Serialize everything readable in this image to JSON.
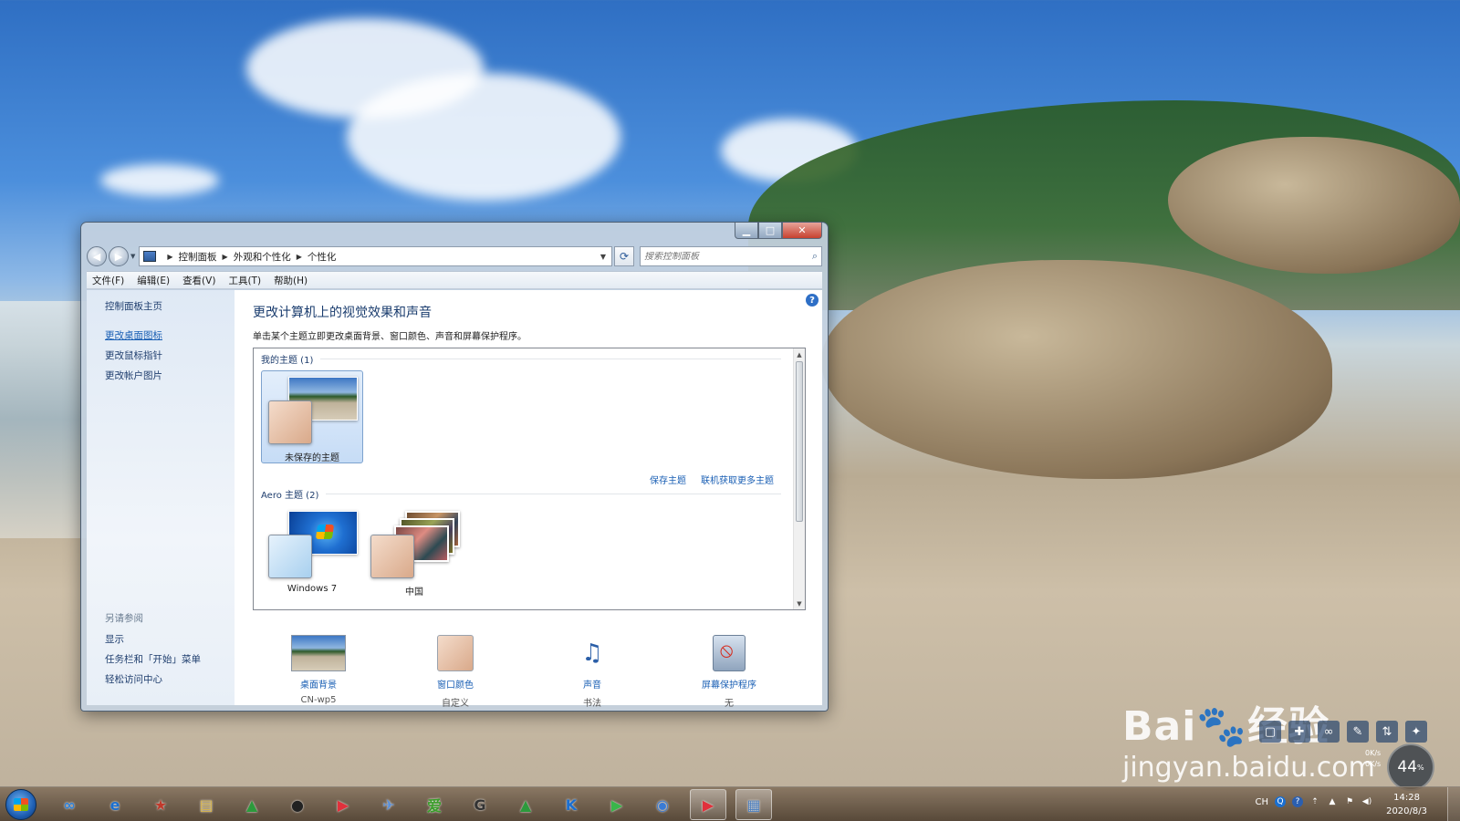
{
  "desktop": {
    "watermark_brand": "Bai",
    "watermark_brand2": "经验",
    "watermark_url": "jingyan.baidu.com",
    "speed_percent": "44",
    "speed_unit": "%",
    "net_up": "0",
    "net_unit": "K/s"
  },
  "window": {
    "caption_buttons": {
      "minimize": "▁",
      "maximize": "□",
      "close": "✕"
    },
    "nav": {
      "back": "◀",
      "forward": "▶"
    },
    "breadcrumb": [
      "控制面板",
      "外观和个性化",
      "个性化"
    ],
    "search_placeholder": "搜索控制面板",
    "menu": [
      "文件(F)",
      "编辑(E)",
      "查看(V)",
      "工具(T)",
      "帮助(H)"
    ],
    "sidebar": {
      "home": "控制面板主页",
      "links": [
        "更改桌面图标",
        "更改鼠标指针",
        "更改帐户图片"
      ],
      "see_also_header": "另请参阅",
      "see_also": [
        "显示",
        "任务栏和「开始」菜单",
        "轻松访问中心"
      ]
    },
    "main": {
      "title": "更改计算机上的视觉效果和声音",
      "description": "单击某个主题立即更改桌面背景、窗口颜色、声音和屏幕保护程序。",
      "my_themes_header": "我的主题 (1)",
      "my_themes": [
        {
          "name": "未保存的主题",
          "selected": true
        }
      ],
      "save_theme": "保存主题",
      "get_more": "联机获取更多主题",
      "aero_header": "Aero 主题 (2)",
      "aero_themes": [
        {
          "name": "Windows 7"
        },
        {
          "name": "中国"
        }
      ],
      "bottom": [
        {
          "label": "桌面背景",
          "sub": "CN-wp5",
          "icon": "wallpaper-icon"
        },
        {
          "label": "窗口颜色",
          "sub": "自定义",
          "icon": "window-color-icon"
        },
        {
          "label": "声音",
          "sub": "书法",
          "icon": "sound-icon"
        },
        {
          "label": "屏幕保护程序",
          "sub": "无",
          "icon": "screensaver-icon"
        }
      ]
    }
  },
  "taskbar": {
    "icons": [
      "baidu-netdisk-icon",
      "ie-icon",
      "app-icon",
      "explorer-icon",
      "app-green-icon",
      "qq-icon",
      "youku-icon",
      "app-bird-icon",
      "iqiyi-icon",
      "app-g-icon",
      "app-green2-icon",
      "kugou-icon",
      "player-icon",
      "browser-icon",
      "youku-active-icon",
      "control-panel-active-icon"
    ],
    "icon_glyphs": [
      "∞",
      "e",
      "★",
      "▤",
      "▲",
      "●",
      "▶",
      "✈",
      "爱",
      "G",
      "▲",
      "K",
      "▶",
      "◉",
      "▶",
      "▦"
    ],
    "tray_lang": "CH",
    "time": "14:28",
    "date": "2020/8/3"
  }
}
